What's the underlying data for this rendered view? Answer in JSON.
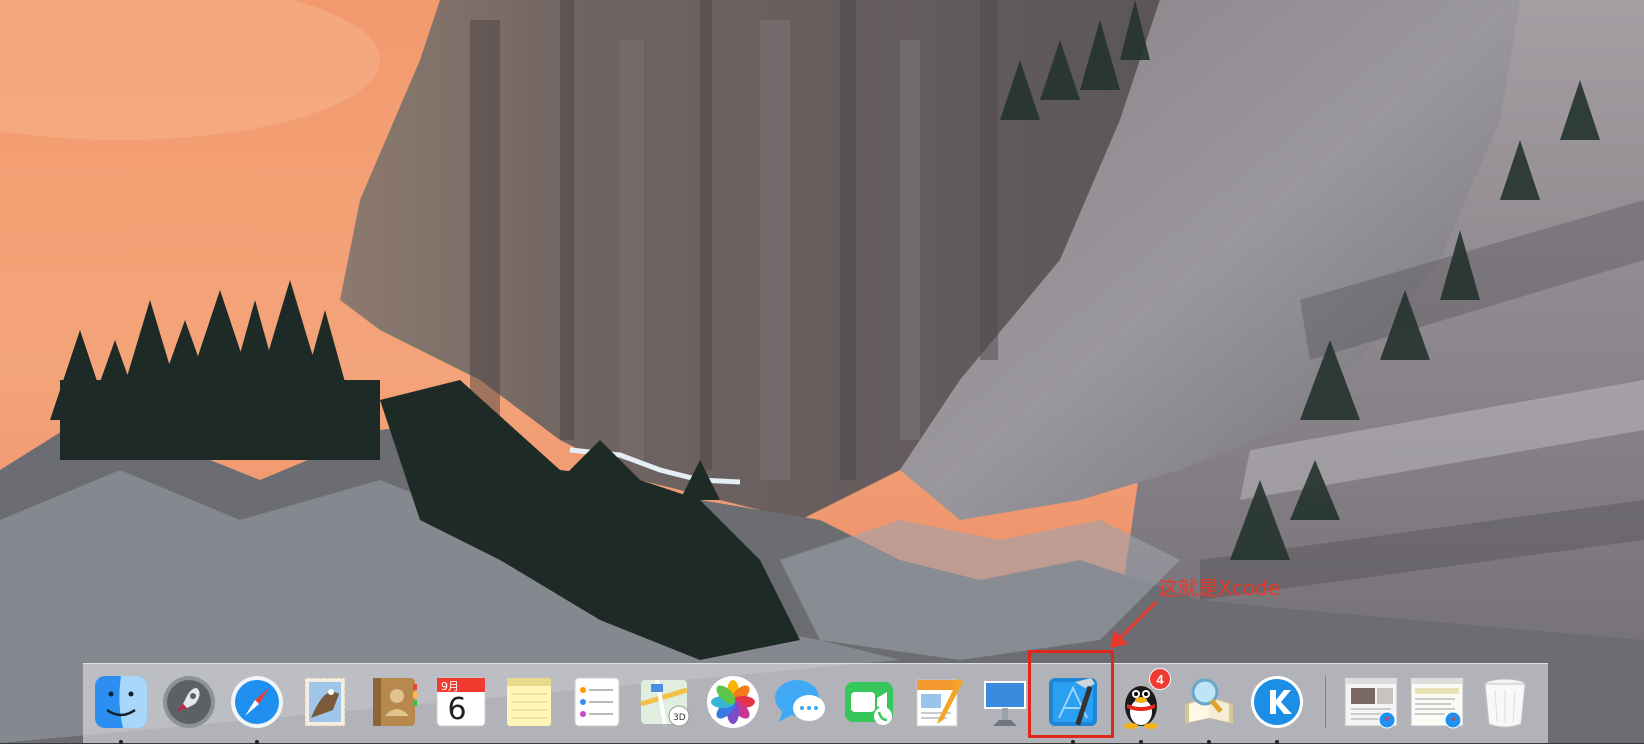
{
  "wallpaper": {
    "name": "yosemite-el-capitan-wallpaper"
  },
  "annotation": {
    "text": "这就是Xcode",
    "color": "#e8382b"
  },
  "dock": {
    "items": [
      {
        "name": "finder",
        "running": true
      },
      {
        "name": "launchpad",
        "running": false
      },
      {
        "name": "safari",
        "running": true
      },
      {
        "name": "mail",
        "running": false
      },
      {
        "name": "contacts",
        "running": false
      },
      {
        "name": "calendar",
        "running": false,
        "month": "9月",
        "day": "6"
      },
      {
        "name": "notes",
        "running": false
      },
      {
        "name": "reminders",
        "running": false
      },
      {
        "name": "maps",
        "running": false
      },
      {
        "name": "photos",
        "running": false
      },
      {
        "name": "messages",
        "running": false
      },
      {
        "name": "facetime",
        "running": false
      },
      {
        "name": "pages",
        "running": false
      },
      {
        "name": "keynote",
        "running": false
      },
      {
        "name": "xcode",
        "running": true,
        "highlighted": true
      },
      {
        "name": "qq",
        "running": true,
        "badge": "4"
      },
      {
        "name": "dictionary",
        "running": true
      },
      {
        "name": "kugou",
        "running": true
      },
      {
        "name": "minimized-safari-window-1",
        "running": false
      },
      {
        "name": "minimized-safari-window-2",
        "running": false
      },
      {
        "name": "trash",
        "running": false
      }
    ]
  },
  "colors": {
    "highlight": "#e0271c",
    "badge": "#f23b30"
  }
}
